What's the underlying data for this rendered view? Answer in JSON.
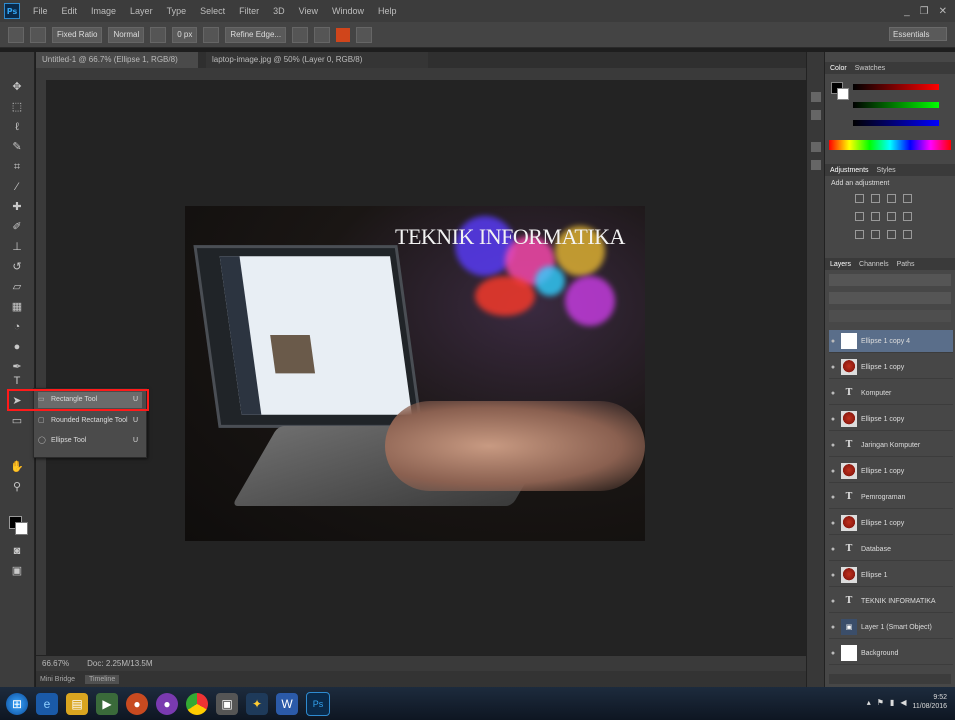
{
  "menubar": {
    "app_logo": "Ps",
    "items": [
      "File",
      "Edit",
      "Image",
      "Layer",
      "Type",
      "Select",
      "Filter",
      "3D",
      "View",
      "Window",
      "Help"
    ],
    "window_buttons": [
      "_",
      "❐",
      "✕"
    ]
  },
  "options": {
    "preset": "Fixed Ratio",
    "style": "Normal",
    "width_value": "0 px",
    "refine_label": "Refine Edge...",
    "workspace": "Essentials"
  },
  "document": {
    "active_tab": "Untitled-1 @ 66.7% (Ellipse 1, RGB/8)",
    "inactive_tab": "laptop-image.jpg @ 50% (Layer 0, RGB/8)"
  },
  "canvas": {
    "title_text": "TEKNIK INFORMATIKA"
  },
  "flyout": {
    "items": [
      {
        "icon": "▭",
        "label": "Rectangle Tool",
        "shortcut": "U"
      },
      {
        "icon": "▢",
        "label": "Rounded Rectangle Tool",
        "shortcut": "U"
      },
      {
        "icon": "◯",
        "label": "Ellipse Tool",
        "shortcut": "U"
      }
    ]
  },
  "status": {
    "zoom": "66.67%",
    "doc_info": "Doc: 2.25M/13.5M"
  },
  "timeline": {
    "tabs": [
      "Mini Bridge",
      "Timeline"
    ]
  },
  "panels": {
    "color_tabs": [
      "Color",
      "Swatches"
    ],
    "adjust_tabs": [
      "Adjustments",
      "Styles"
    ],
    "adjust_title": "Add an adjustment",
    "layer_tabs": [
      "Layers",
      "Channels",
      "Paths"
    ],
    "layers": [
      {
        "name": "Ellipse 1 copy 4",
        "thumb": "white",
        "active": true
      },
      {
        "name": "Ellipse 1 copy",
        "thumb": "img",
        "active": false
      },
      {
        "name": "Komputer",
        "thumb": "text",
        "active": false
      },
      {
        "name": "Ellipse 1 copy",
        "thumb": "img",
        "active": false
      },
      {
        "name": "Jaringan Komputer",
        "thumb": "text",
        "active": false
      },
      {
        "name": "Ellipse 1 copy",
        "thumb": "img",
        "active": false
      },
      {
        "name": "Pemrograman",
        "thumb": "text",
        "active": false
      },
      {
        "name": "Ellipse 1 copy",
        "thumb": "img",
        "active": false
      },
      {
        "name": "Database",
        "thumb": "text",
        "active": false
      },
      {
        "name": "Ellipse 1",
        "thumb": "img",
        "active": false
      },
      {
        "name": "TEKNIK INFORMATIKA",
        "thumb": "text",
        "active": false
      },
      {
        "name": "Layer 1 (Smart Object)",
        "thumb": "ps",
        "active": false
      },
      {
        "name": "Background",
        "thumb": "white",
        "active": false
      }
    ]
  },
  "taskbar": {
    "clock_time": "9:52",
    "clock_date": "11/08/2016"
  }
}
